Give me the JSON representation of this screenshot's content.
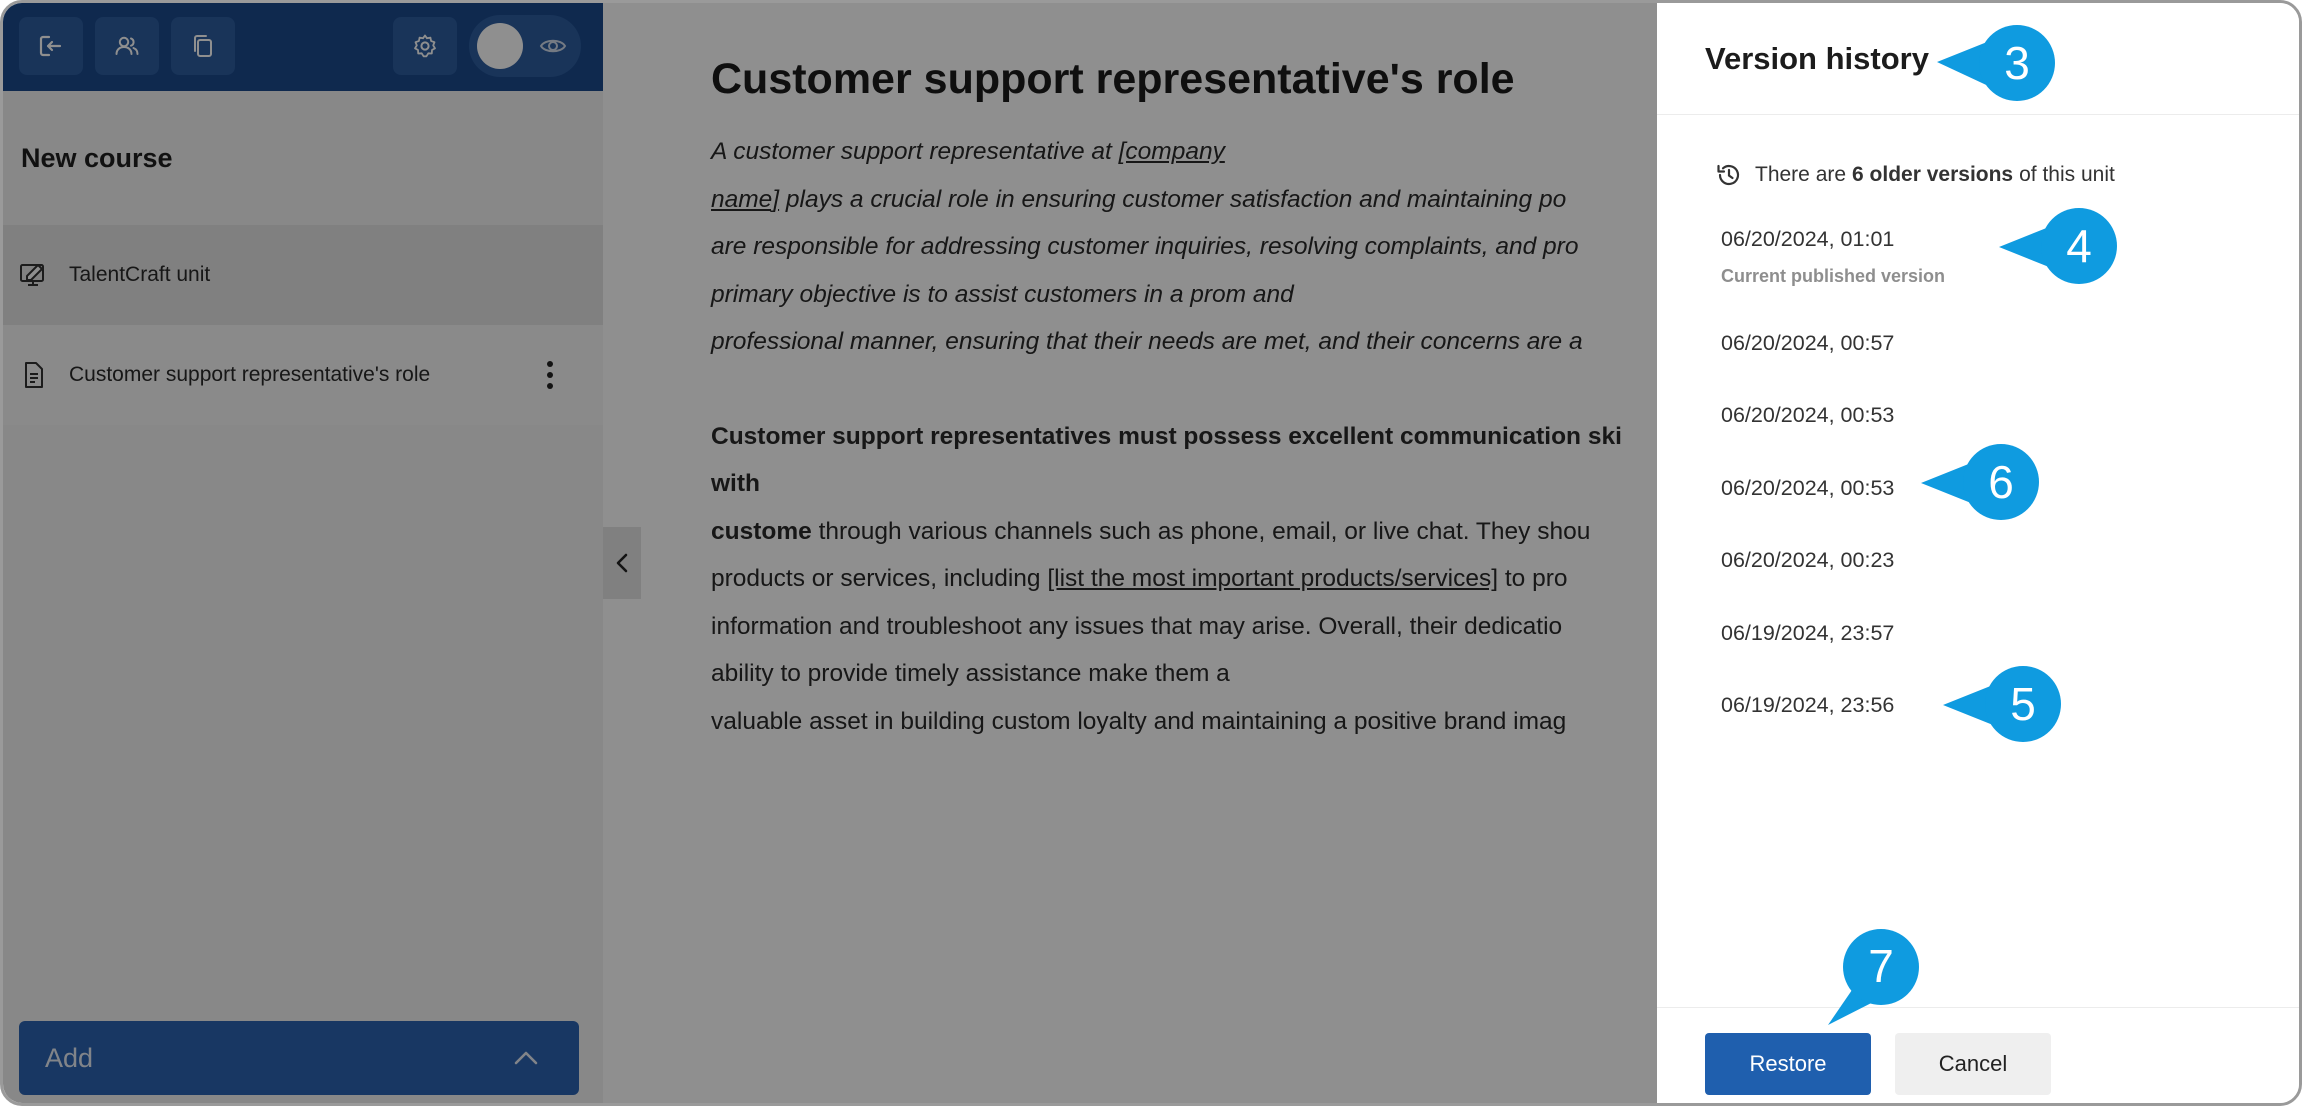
{
  "sidebar": {
    "course_title": "New course",
    "items": [
      {
        "label": "TalentCraft unit",
        "icon": "monitor-edit-icon"
      },
      {
        "label": "Customer support representative's role",
        "icon": "document-icon"
      }
    ],
    "add_label": "Add"
  },
  "main": {
    "heading": "Customer support representative's role",
    "p1": {
      "l1": "A customer support representative at ",
      "l1_link": "[company",
      "l2_link": "name]",
      "l2": " plays a crucial role in ensuring customer satisfaction and maintaining po",
      "l3": "are responsible for addressing customer inquiries, resolving complaints, and pro",
      "l4": "primary objective is to assist customers in a prom and",
      "l5": "professional manner, ensuring that their needs are met, and their concerns are a"
    },
    "p2": {
      "l1": "Customer support representatives must possess excellent communication ski",
      "l2": "with",
      "l3_bold": "custome",
      "l3": " through various channels such as phone, email, or live chat. They shou",
      "l4a": "products or services, including ",
      "l4_link": "[list the most important products/services]",
      "l4b": " to pro",
      "l5": "information and troubleshoot any issues that may arise. Overall, their dedicatio",
      "l6": "ability to provide timely assistance make them a",
      "l7": "valuable asset in building custom loyalty and maintaining a positive brand imag"
    }
  },
  "panel": {
    "title": "Version history",
    "info_prefix": "There are ",
    "info_bold": "6 older versions",
    "info_suffix": " of this unit",
    "versions": [
      {
        "date": "06/20/2024, 01:01",
        "note": "Current published version"
      },
      {
        "date": "06/20/2024, 00:57"
      },
      {
        "date": "06/20/2024, 00:53"
      },
      {
        "date": "06/20/2024, 00:53"
      },
      {
        "date": "06/20/2024, 00:23"
      },
      {
        "date": "06/19/2024, 23:57"
      },
      {
        "date": "06/19/2024, 23:56"
      }
    ],
    "restore_label": "Restore",
    "cancel_label": "Cancel"
  },
  "callouts": [
    "3",
    "4",
    "5",
    "6",
    "7"
  ],
  "colors": {
    "topbar": "#1b4a8c",
    "accent": "#1f5fae",
    "callout": "#0f9be0"
  }
}
